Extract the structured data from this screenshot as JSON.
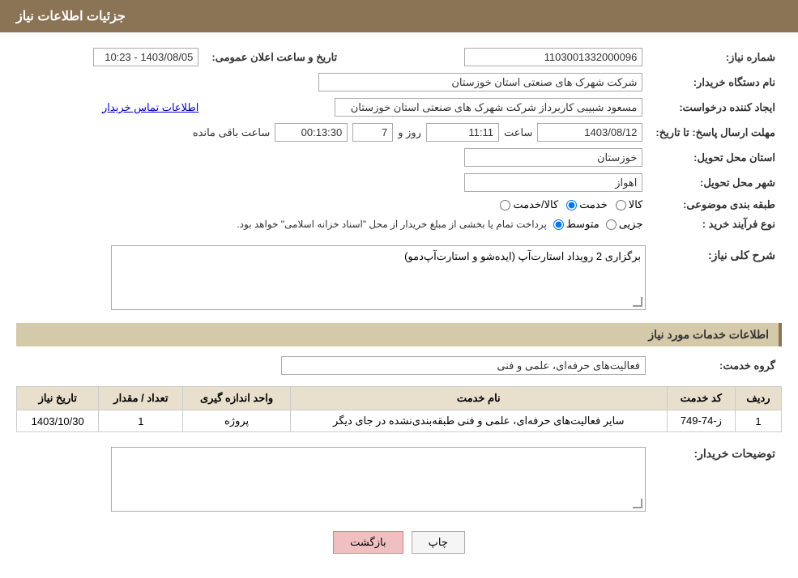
{
  "header": {
    "title": "جزئیات اطلاعات نیاز"
  },
  "fields": {
    "shomareNiaz_label": "شماره نیاز:",
    "shomareNiaz_value": "1103001332000096",
    "namDastgah_label": "نام دستگاه خریدار:",
    "namDastgah_value": "شرکت شهرک های صنعتی استان خوزستان",
    "tarikh_label": "تاریخ و ساعت اعلان عمومی:",
    "tarikh_value": "1403/08/05 - 10:23",
    "ijadKonande_label": "ایجاد کننده درخواست:",
    "ijadKonande_value": "مسعود شبیبی کاربرداز شرکت شهرک های صنعتی استان خوزستان",
    "etelaat_link": "اطلاعات تماس خریدار",
    "mohlat_label": "مهلت ارسال پاسخ: تا تاریخ:",
    "mohlat_date": "1403/08/12",
    "mohlat_saat_label": "ساعت",
    "mohlat_saat_value": "11:11",
    "mohlat_roz_label": "روز و",
    "mohlat_roz_value": "7",
    "mohlat_baqi_label": "ساعت باقی مانده",
    "mohlat_baqi_value": "00:13:30",
    "ostan_label": "استان محل تحویل:",
    "ostan_value": "خوزستان",
    "shahr_label": "شهر محل تحویل:",
    "shahr_value": "اهواز",
    "tabaqe_label": "طبقه بندی موضوعی:",
    "tabaqe_options": [
      "کالا",
      "خدمت",
      "کالا/خدمت"
    ],
    "tabaqe_selected": "خدمت",
    "noeFarayand_label": "نوع فرآیند خرید :",
    "noeFarayand_options": [
      "جزیی",
      "متوسط"
    ],
    "noeFarayand_selected": "متوسط",
    "noeFarayand_note": "پرداخت تمام یا بخشی از مبلغ خریدار از محل \"اسناد خزانه اسلامی\" خواهد بود.",
    "sharhKoli_label": "شرح کلی نیاز:",
    "sharhKoli_value": "برگزاری 2 رویداد استارت‌آپ (ایده‌شو و استارت‌آپ‌دمو)",
    "khadamat_section": "اطلاعات خدمات مورد نیاز",
    "groheKhedmat_label": "گروه خدمت:",
    "groheKhedmat_value": "فعالیت‌های حرفه‌ای، علمی و فنی",
    "table_headers": [
      "ردیف",
      "کد خدمت",
      "نام خدمت",
      "واحد اندازه گیری",
      "تعداد / مقدار",
      "تاریخ نیاز"
    ],
    "table_rows": [
      {
        "radif": "1",
        "kodKhedmat": "ز-74-749",
        "namKhedmat": "سایر فعالیت‌های حرفه‌ای، علمی و فنی طبقه‌بندی‌نشده در جای دیگر",
        "vahed": "پروژه",
        "tedad": "1",
        "tarikh": "1403/10/30"
      }
    ],
    "description_label": "توضیحات خریدار:",
    "description_value": "",
    "btn_print": "چاپ",
    "btn_back": "بازگشت"
  }
}
